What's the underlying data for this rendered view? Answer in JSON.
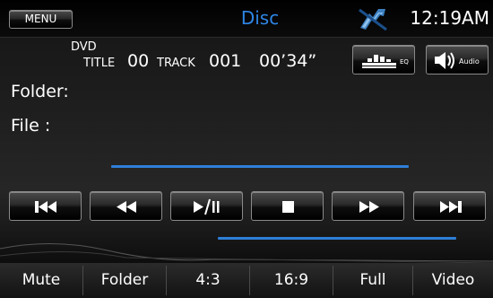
{
  "top_bar": {
    "menu_label": "MENU",
    "source_title": "Disc",
    "clock": "12:19AM",
    "status_icon": "no-signal-icon"
  },
  "info": {
    "disc_type": "DVD",
    "title_label": "TITLE",
    "title_value": "00",
    "track_label": "TRACK",
    "track_value": "001",
    "elapsed": "00’34”"
  },
  "quick_buttons": {
    "eq_label": "EQ",
    "audio_label": "Audio"
  },
  "media": {
    "folder_label": "Folder:",
    "file_label": "File   :"
  },
  "transport": [
    {
      "name": "previous-track",
      "icon": "skip-back-icon"
    },
    {
      "name": "rewind",
      "icon": "rewind-icon"
    },
    {
      "name": "play-pause",
      "icon": "play-pause-icon",
      "label": "▶/II"
    },
    {
      "name": "stop",
      "icon": "stop-icon"
    },
    {
      "name": "fast-forward",
      "icon": "fast-forward-icon"
    },
    {
      "name": "next-track",
      "icon": "skip-forward-icon"
    }
  ],
  "bottom_bar": {
    "buttons": [
      "Mute",
      "Folder",
      "4:3",
      "16:9",
      "Full",
      "Video"
    ]
  },
  "colors": {
    "accent_blue": "#2e86e6",
    "line_blue": "#2e7fd8",
    "background": "#1a1a1a"
  }
}
